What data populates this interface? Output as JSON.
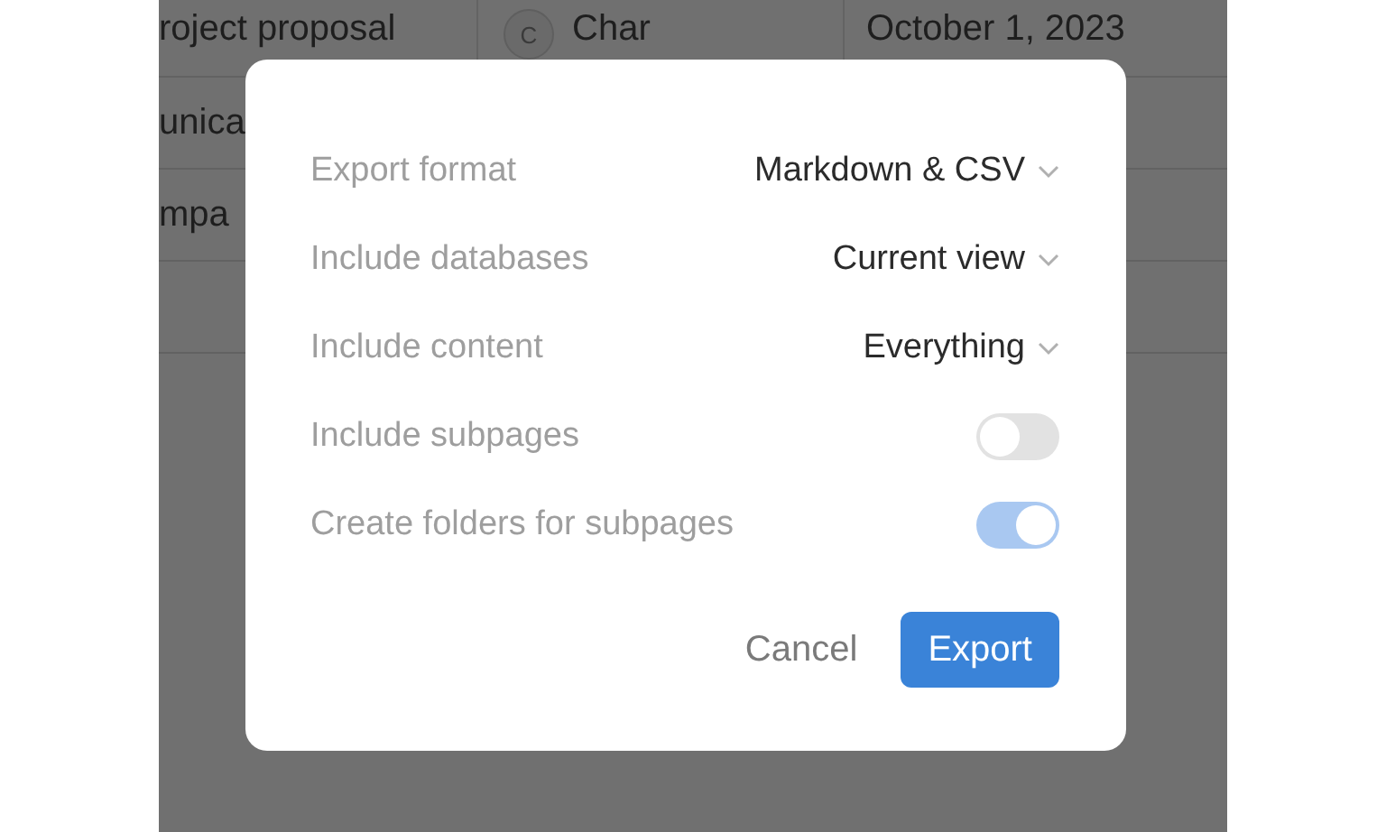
{
  "background_table": {
    "rows": [
      {
        "title": "roject proposal",
        "owner_initial": "C",
        "owner": "Char",
        "date": "October 1, 2023"
      },
      {
        "title": "unica"
      },
      {
        "title": "mpa"
      }
    ]
  },
  "export_dialog": {
    "settings": [
      {
        "kind": "dropdown",
        "label": "Export format",
        "value": "Markdown & CSV"
      },
      {
        "kind": "dropdown",
        "label": "Include databases",
        "value": "Current view"
      },
      {
        "kind": "dropdown",
        "label": "Include content",
        "value": "Everything"
      },
      {
        "kind": "toggle",
        "label": "Include subpages",
        "on": false
      },
      {
        "kind": "toggle",
        "label": "Create folders for subpages",
        "on": true
      }
    ],
    "buttons": [
      {
        "kind": "secondary",
        "label": "Cancel"
      },
      {
        "kind": "primary",
        "label": "Export"
      }
    ]
  }
}
